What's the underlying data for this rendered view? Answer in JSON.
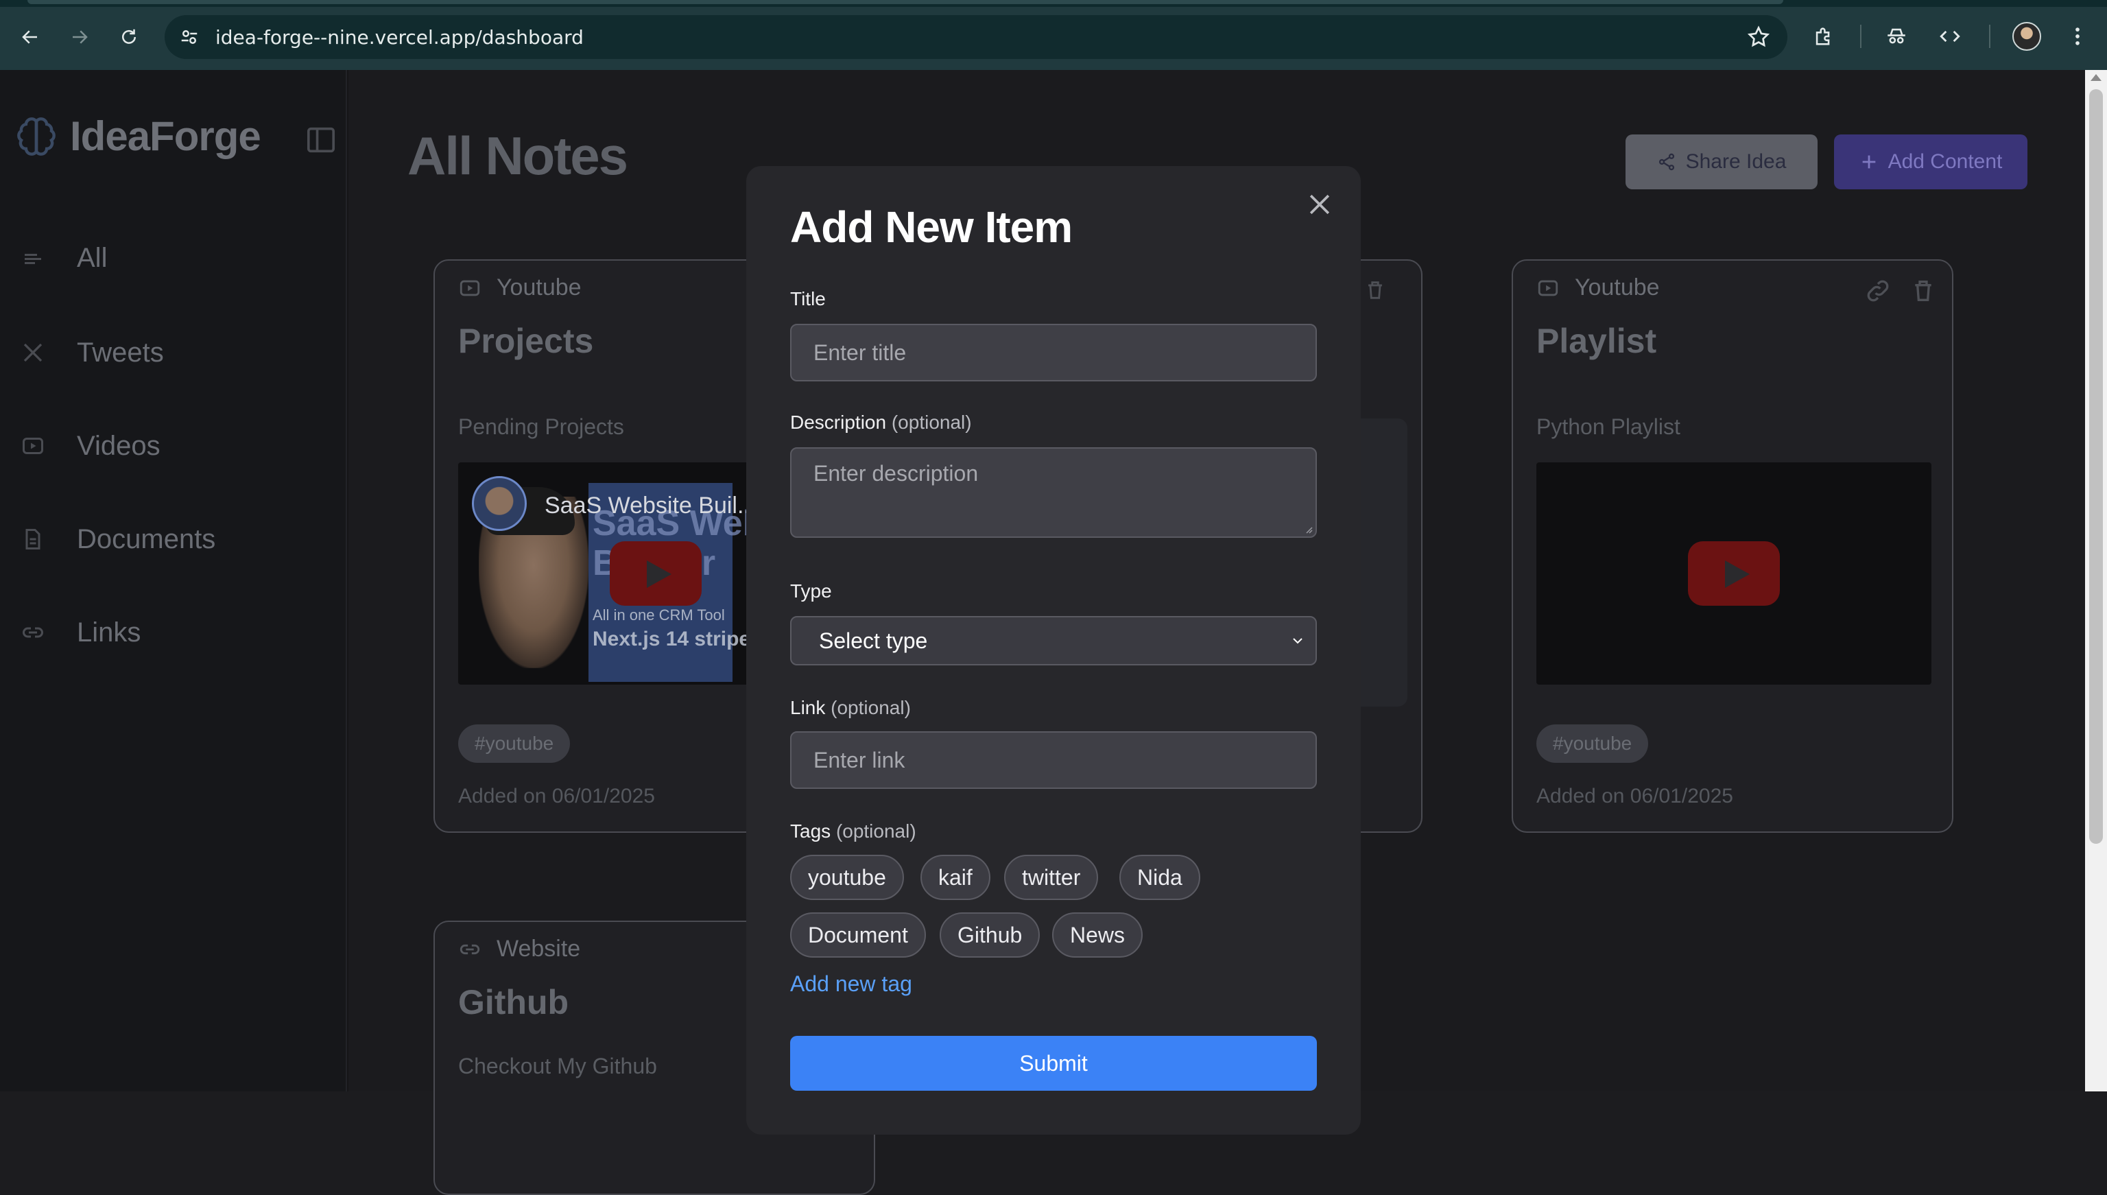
{
  "browser": {
    "url": "idea-forge--nine.vercel.app/dashboard"
  },
  "sidebar": {
    "brand": "IdeaForge",
    "items": [
      {
        "label": "All",
        "icon": "lines-icon"
      },
      {
        "label": "Tweets",
        "icon": "x-logo-icon"
      },
      {
        "label": "Videos",
        "icon": "video-icon"
      },
      {
        "label": "Documents",
        "icon": "document-icon"
      },
      {
        "label": "Links",
        "icon": "link-icon"
      }
    ]
  },
  "main": {
    "title": "All Notes",
    "share_label": "Share Idea",
    "add_label": "Add Content"
  },
  "cards": [
    {
      "kind": "Youtube",
      "title": "Projects",
      "desc": "Pending Projects",
      "tag": "#youtube",
      "added": "Added on 06/01/2025",
      "thumb": {
        "video_title": "SaaS Website Buil...",
        "big": "SaaS Website Builder",
        "small": "All in one CRM Tool",
        "next": "Next.js 14 stripe"
      }
    },
    {
      "kind": "Youtube",
      "title": "Playlist",
      "desc": "Python Playlist",
      "tag": "#youtube",
      "added": "Added on 06/01/2025"
    },
    {
      "kind": "Website",
      "title": "Github",
      "desc": "Checkout My Github"
    }
  ],
  "modal": {
    "title": "Add New Item",
    "title_label": "Title",
    "title_placeholder": "Enter title",
    "desc_label": "Description",
    "desc_optional": "(optional)",
    "desc_placeholder": "Enter description",
    "type_label": "Type",
    "type_value": "Select type",
    "link_label": "Link",
    "link_optional": "(optional)",
    "link_placeholder": "Enter link",
    "tags_label": "Tags",
    "tags_optional": "(optional)",
    "tags": [
      "youtube",
      "kaif",
      "twitter",
      "Nida",
      "Document",
      "Github",
      "News"
    ],
    "add_tag": "Add new tag",
    "submit": "Submit"
  },
  "colors": {
    "accent": "#3b82f6",
    "link": "#5aa0f8",
    "chrome": "#203a3e"
  }
}
